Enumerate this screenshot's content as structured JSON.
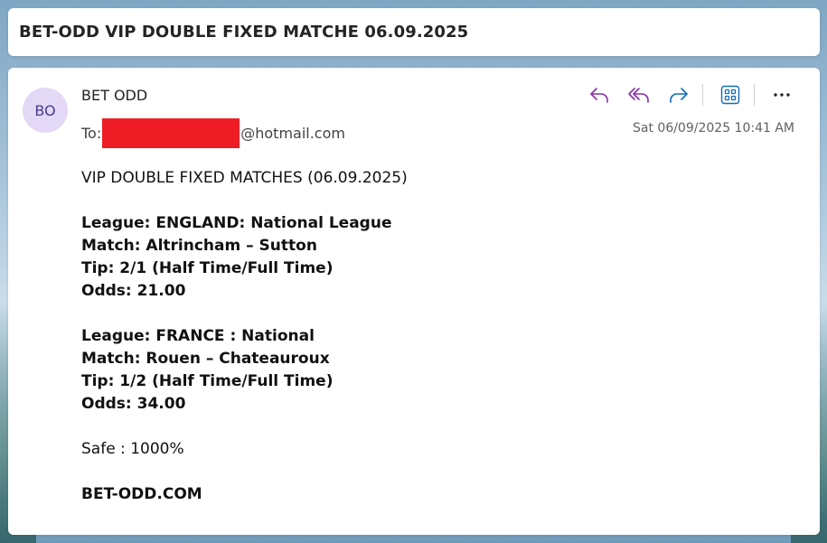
{
  "subject": "BET-ODD VIP DOUBLE FIXED MATCHE 06.09.2025",
  "message": {
    "avatar_initials": "BO",
    "sender": "BET ODD",
    "to_label": "To:",
    "to_domain": "@hotmail.com",
    "date": "Sat 06/09/2025 10:41 AM",
    "actions": [
      {
        "name": "reply",
        "icon": "reply-icon"
      },
      {
        "name": "reply-all",
        "icon": "reply-all-icon"
      },
      {
        "name": "forward",
        "icon": "forward-icon"
      },
      {
        "name": "apps",
        "icon": "apps-grid-icon"
      },
      {
        "name": "more",
        "icon": "more-options-icon"
      }
    ],
    "accent_color": "#8a2fa8",
    "forward_color": "#0f6cbd",
    "redaction_color": "#ee1c25"
  },
  "body": {
    "intro": "VIP DOUBLE FIXED MATCHES (06.09.2025)",
    "matches": [
      {
        "league": "League: ENGLAND: National League",
        "match": "Match: Altrincham – Sutton",
        "tip": "Tip: 2/1 (Half Time/Full Time)",
        "odds": "Odds: 21.00"
      },
      {
        "league": "League: FRANCE : National",
        "match": "Match: Rouen – Chateauroux",
        "tip": "Tip: 1/2 (Half Time/Full Time)",
        "odds": "Odds: 34.00"
      }
    ],
    "safe": "Safe : 1000%",
    "site": "BET-ODD.COM"
  }
}
